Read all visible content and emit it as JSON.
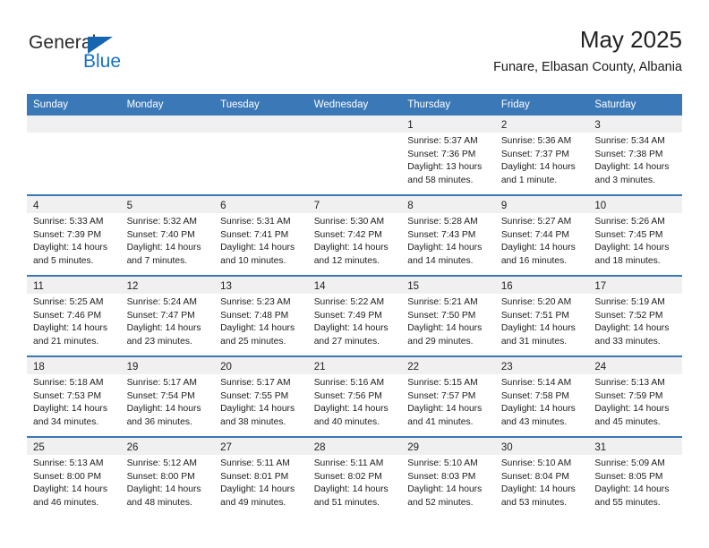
{
  "brand": {
    "name_top": "General",
    "name_bottom": "Blue",
    "triangle_color": "#1565b0",
    "blue_color": "#1572c6"
  },
  "header": {
    "title": "May 2025",
    "subtitle": "Funare, Elbasan County, Albania"
  },
  "theme": {
    "header_bar": "#3b78b8",
    "daynum_band": "#f0f0f0",
    "separator": "#3b78b8",
    "text": "#1c1c1c"
  },
  "weekday_headers": [
    "Sunday",
    "Monday",
    "Tuesday",
    "Wednesday",
    "Thursday",
    "Friday",
    "Saturday"
  ],
  "labels": {
    "sunrise_prefix": "Sunrise:",
    "sunset_prefix": "Sunset:",
    "daylight_prefix": "Daylight:"
  },
  "weeks": [
    [
      {
        "empty": true
      },
      {
        "empty": true
      },
      {
        "empty": true
      },
      {
        "empty": true
      },
      {
        "day": "1",
        "sunrise": "Sunrise: 5:37 AM",
        "sunset": "Sunset: 7:36 PM",
        "daylight1": "Daylight: 13 hours",
        "daylight2": "and 58 minutes."
      },
      {
        "day": "2",
        "sunrise": "Sunrise: 5:36 AM",
        "sunset": "Sunset: 7:37 PM",
        "daylight1": "Daylight: 14 hours",
        "daylight2": "and 1 minute."
      },
      {
        "day": "3",
        "sunrise": "Sunrise: 5:34 AM",
        "sunset": "Sunset: 7:38 PM",
        "daylight1": "Daylight: 14 hours",
        "daylight2": "and 3 minutes."
      }
    ],
    [
      {
        "day": "4",
        "sunrise": "Sunrise: 5:33 AM",
        "sunset": "Sunset: 7:39 PM",
        "daylight1": "Daylight: 14 hours",
        "daylight2": "and 5 minutes."
      },
      {
        "day": "5",
        "sunrise": "Sunrise: 5:32 AM",
        "sunset": "Sunset: 7:40 PM",
        "daylight1": "Daylight: 14 hours",
        "daylight2": "and 7 minutes."
      },
      {
        "day": "6",
        "sunrise": "Sunrise: 5:31 AM",
        "sunset": "Sunset: 7:41 PM",
        "daylight1": "Daylight: 14 hours",
        "daylight2": "and 10 minutes."
      },
      {
        "day": "7",
        "sunrise": "Sunrise: 5:30 AM",
        "sunset": "Sunset: 7:42 PM",
        "daylight1": "Daylight: 14 hours",
        "daylight2": "and 12 minutes."
      },
      {
        "day": "8",
        "sunrise": "Sunrise: 5:28 AM",
        "sunset": "Sunset: 7:43 PM",
        "daylight1": "Daylight: 14 hours",
        "daylight2": "and 14 minutes."
      },
      {
        "day": "9",
        "sunrise": "Sunrise: 5:27 AM",
        "sunset": "Sunset: 7:44 PM",
        "daylight1": "Daylight: 14 hours",
        "daylight2": "and 16 minutes."
      },
      {
        "day": "10",
        "sunrise": "Sunrise: 5:26 AM",
        "sunset": "Sunset: 7:45 PM",
        "daylight1": "Daylight: 14 hours",
        "daylight2": "and 18 minutes."
      }
    ],
    [
      {
        "day": "11",
        "sunrise": "Sunrise: 5:25 AM",
        "sunset": "Sunset: 7:46 PM",
        "daylight1": "Daylight: 14 hours",
        "daylight2": "and 21 minutes."
      },
      {
        "day": "12",
        "sunrise": "Sunrise: 5:24 AM",
        "sunset": "Sunset: 7:47 PM",
        "daylight1": "Daylight: 14 hours",
        "daylight2": "and 23 minutes."
      },
      {
        "day": "13",
        "sunrise": "Sunrise: 5:23 AM",
        "sunset": "Sunset: 7:48 PM",
        "daylight1": "Daylight: 14 hours",
        "daylight2": "and 25 minutes."
      },
      {
        "day": "14",
        "sunrise": "Sunrise: 5:22 AM",
        "sunset": "Sunset: 7:49 PM",
        "daylight1": "Daylight: 14 hours",
        "daylight2": "and 27 minutes."
      },
      {
        "day": "15",
        "sunrise": "Sunrise: 5:21 AM",
        "sunset": "Sunset: 7:50 PM",
        "daylight1": "Daylight: 14 hours",
        "daylight2": "and 29 minutes."
      },
      {
        "day": "16",
        "sunrise": "Sunrise: 5:20 AM",
        "sunset": "Sunset: 7:51 PM",
        "daylight1": "Daylight: 14 hours",
        "daylight2": "and 31 minutes."
      },
      {
        "day": "17",
        "sunrise": "Sunrise: 5:19 AM",
        "sunset": "Sunset: 7:52 PM",
        "daylight1": "Daylight: 14 hours",
        "daylight2": "and 33 minutes."
      }
    ],
    [
      {
        "day": "18",
        "sunrise": "Sunrise: 5:18 AM",
        "sunset": "Sunset: 7:53 PM",
        "daylight1": "Daylight: 14 hours",
        "daylight2": "and 34 minutes."
      },
      {
        "day": "19",
        "sunrise": "Sunrise: 5:17 AM",
        "sunset": "Sunset: 7:54 PM",
        "daylight1": "Daylight: 14 hours",
        "daylight2": "and 36 minutes."
      },
      {
        "day": "20",
        "sunrise": "Sunrise: 5:17 AM",
        "sunset": "Sunset: 7:55 PM",
        "daylight1": "Daylight: 14 hours",
        "daylight2": "and 38 minutes."
      },
      {
        "day": "21",
        "sunrise": "Sunrise: 5:16 AM",
        "sunset": "Sunset: 7:56 PM",
        "daylight1": "Daylight: 14 hours",
        "daylight2": "and 40 minutes."
      },
      {
        "day": "22",
        "sunrise": "Sunrise: 5:15 AM",
        "sunset": "Sunset: 7:57 PM",
        "daylight1": "Daylight: 14 hours",
        "daylight2": "and 41 minutes."
      },
      {
        "day": "23",
        "sunrise": "Sunrise: 5:14 AM",
        "sunset": "Sunset: 7:58 PM",
        "daylight1": "Daylight: 14 hours",
        "daylight2": "and 43 minutes."
      },
      {
        "day": "24",
        "sunrise": "Sunrise: 5:13 AM",
        "sunset": "Sunset: 7:59 PM",
        "daylight1": "Daylight: 14 hours",
        "daylight2": "and 45 minutes."
      }
    ],
    [
      {
        "day": "25",
        "sunrise": "Sunrise: 5:13 AM",
        "sunset": "Sunset: 8:00 PM",
        "daylight1": "Daylight: 14 hours",
        "daylight2": "and 46 minutes."
      },
      {
        "day": "26",
        "sunrise": "Sunrise: 5:12 AM",
        "sunset": "Sunset: 8:00 PM",
        "daylight1": "Daylight: 14 hours",
        "daylight2": "and 48 minutes."
      },
      {
        "day": "27",
        "sunrise": "Sunrise: 5:11 AM",
        "sunset": "Sunset: 8:01 PM",
        "daylight1": "Daylight: 14 hours",
        "daylight2": "and 49 minutes."
      },
      {
        "day": "28",
        "sunrise": "Sunrise: 5:11 AM",
        "sunset": "Sunset: 8:02 PM",
        "daylight1": "Daylight: 14 hours",
        "daylight2": "and 51 minutes."
      },
      {
        "day": "29",
        "sunrise": "Sunrise: 5:10 AM",
        "sunset": "Sunset: 8:03 PM",
        "daylight1": "Daylight: 14 hours",
        "daylight2": "and 52 minutes."
      },
      {
        "day": "30",
        "sunrise": "Sunrise: 5:10 AM",
        "sunset": "Sunset: 8:04 PM",
        "daylight1": "Daylight: 14 hours",
        "daylight2": "and 53 minutes."
      },
      {
        "day": "31",
        "sunrise": "Sunrise: 5:09 AM",
        "sunset": "Sunset: 8:05 PM",
        "daylight1": "Daylight: 14 hours",
        "daylight2": "and 55 minutes."
      }
    ]
  ]
}
